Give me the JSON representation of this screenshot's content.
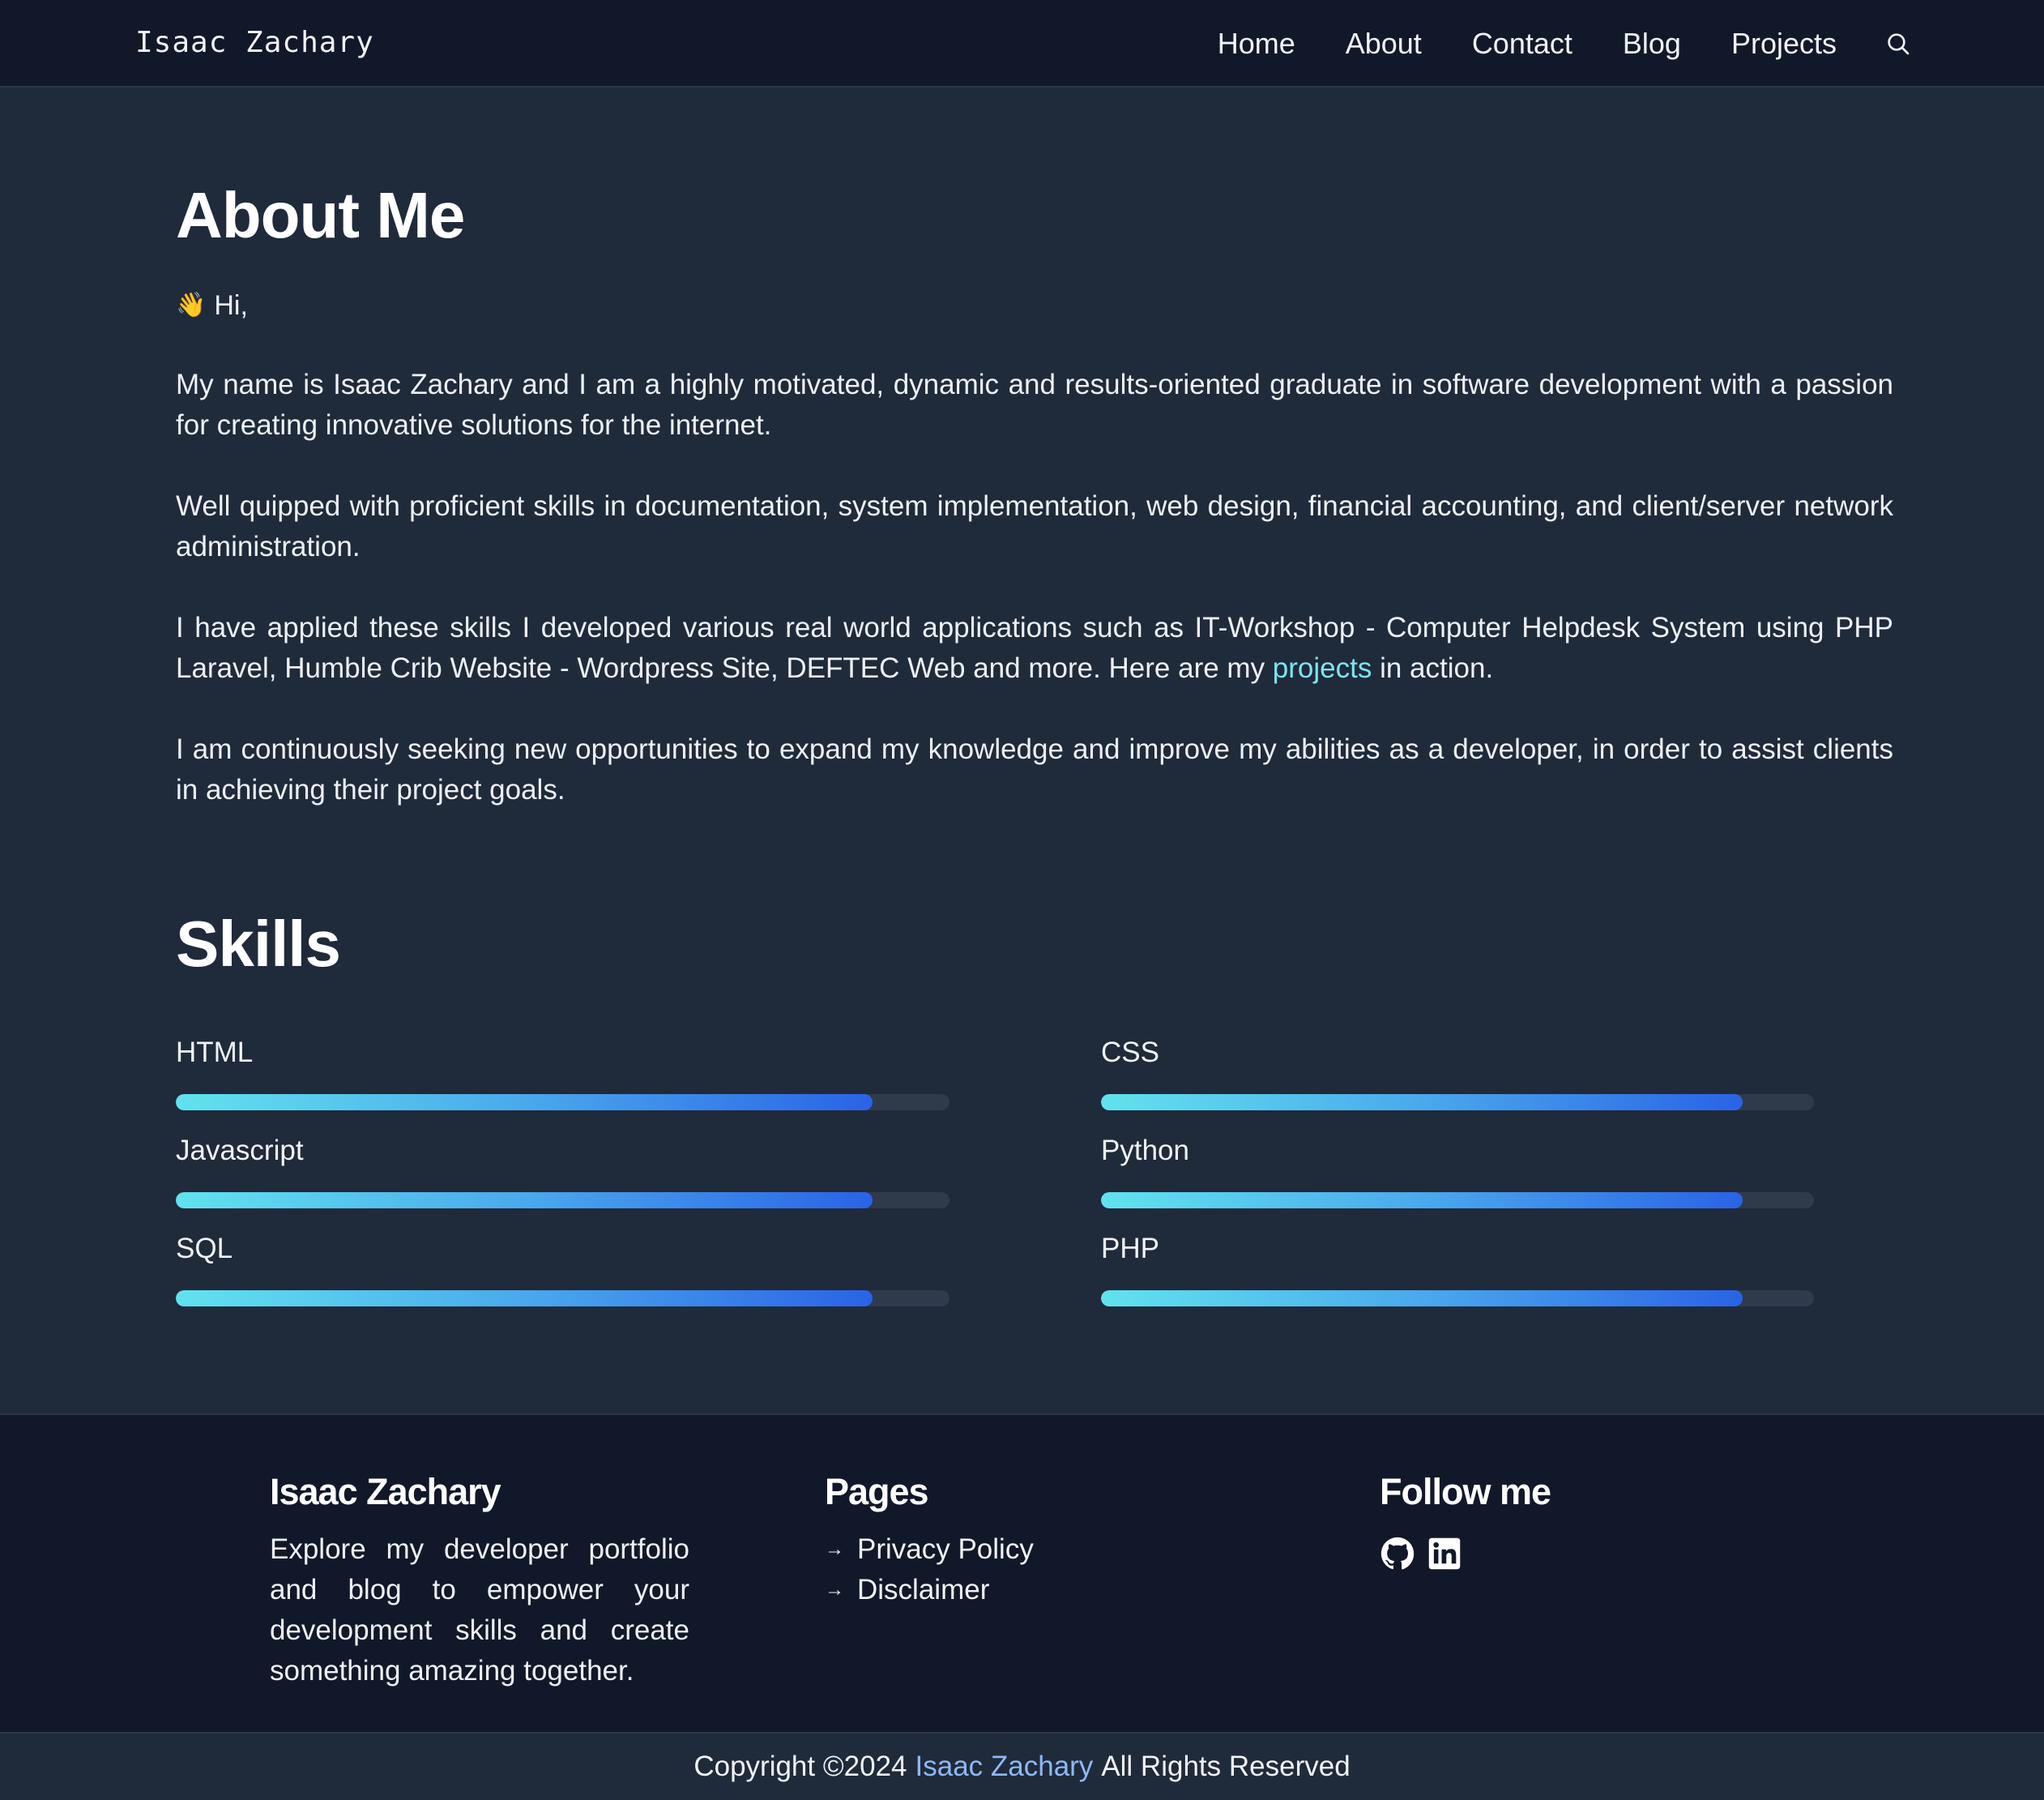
{
  "header": {
    "brand": "Isaac Zachary",
    "nav": [
      "Home",
      "About",
      "Contact",
      "Blog",
      "Projects"
    ],
    "search_icon": "search-icon"
  },
  "about": {
    "title": "About Me",
    "wave_icon": "👋",
    "greeting": "Hi,",
    "paragraphs": [
      "My name is Isaac Zachary and I am a highly motivated, dynamic and results-oriented graduate in software development with a passion for creating innovative solutions for the internet.",
      "Well quipped with proficient skills in documentation, system implementation, web design, financial accounting, and client/server network administration.",
      "I am continuously seeking new opportunities to expand my knowledge and improve my abilities as a developer, in order to assist clients in achieving their project goals."
    ],
    "projects_paragraph": {
      "before": "I have applied these skills I developed various real world applications such as IT-Workshop - Computer Helpdesk System using PHP Laravel, Humble Crib Website - Wordpress Site, DEFTEC Web and more. Here are my ",
      "link": "projects",
      "after": " in action."
    }
  },
  "skills": {
    "title": "Skills",
    "items": [
      {
        "name": "HTML",
        "level": 0.9
      },
      {
        "name": "CSS",
        "level": 0.9
      },
      {
        "name": "Javascript",
        "level": 0.9
      },
      {
        "name": "Python",
        "level": 0.9
      },
      {
        "name": "SQL",
        "level": 0.9
      },
      {
        "name": "PHP",
        "level": 0.9
      }
    ]
  },
  "footer": {
    "brand_title": "Isaac Zachary",
    "description": "Explore my developer portfolio and blog to empower your development skills and create something amazing together.",
    "pages_title": "Pages",
    "pages": [
      "Privacy Policy",
      "Disclaimer"
    ],
    "follow_title": "Follow me",
    "social": [
      "github-icon",
      "linkedin-icon"
    ]
  },
  "copyright": {
    "before": "Copyright ©2024",
    "link": "Isaac Zachary",
    "after": "All Rights Reserved"
  },
  "colors": {
    "header_bg": "#111829",
    "page_bg": "#1f2a3b",
    "link": "#7fe3ee",
    "copyright_link": "#8fb8f5",
    "bar_start": "#61e3ee",
    "bar_end": "#2a63e6"
  }
}
